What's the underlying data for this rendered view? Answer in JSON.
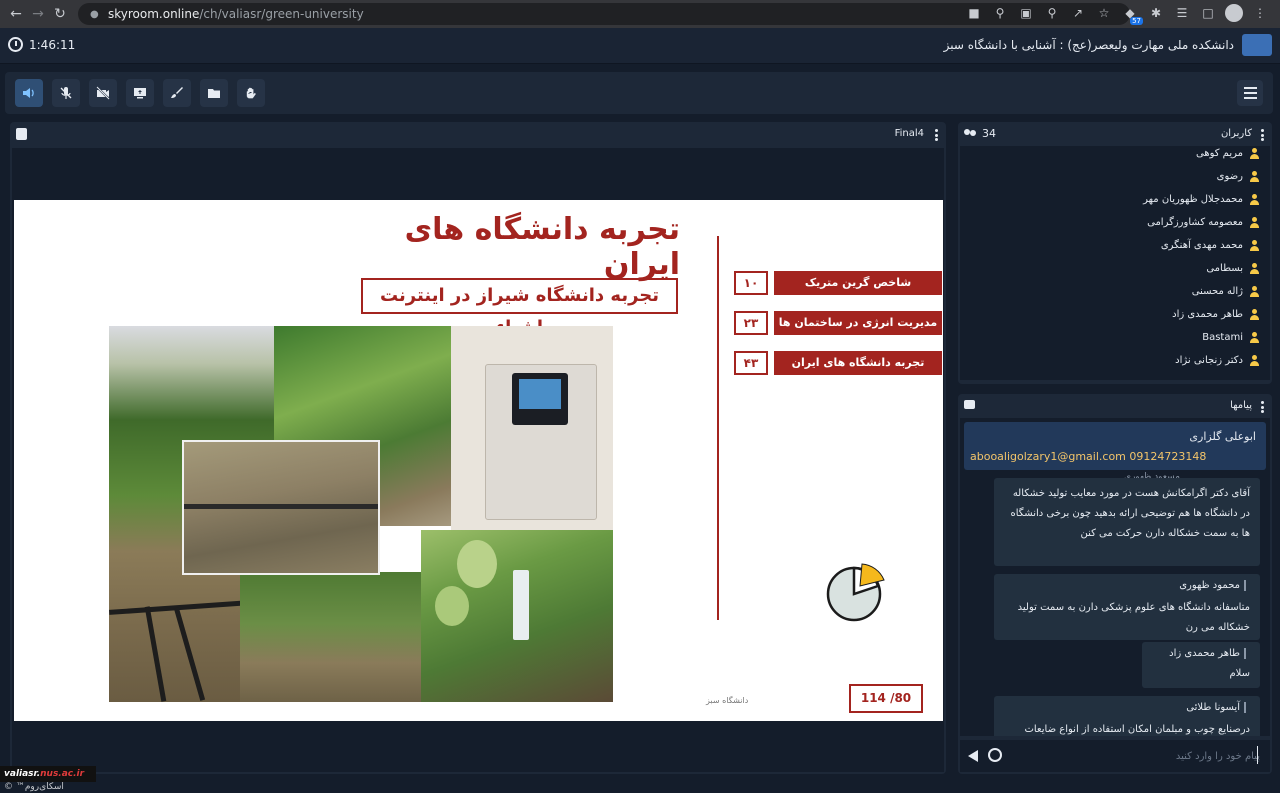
{
  "browser": {
    "url_host": "skyroom.online",
    "url_path": "/ch/valiasr/green-university",
    "extension_badge": "57"
  },
  "header": {
    "timer": "1:46:11",
    "title": "دانشکده ملی مهارت ولیعصر(عج) : آشنایی با دانشگاه سبز"
  },
  "presentation": {
    "file_name": "Final4",
    "slide": {
      "title": "تجربه دانشگاه های ایران",
      "subtitle": "تجربه دانشگاه شیراز در اینترنت اشیاء",
      "toc": [
        {
          "num": "۱۰",
          "label": "شاخص گرین متریک"
        },
        {
          "num": "۲۳",
          "label": "مدیریت انرژی در ساختمان ها"
        },
        {
          "num": "۴۳",
          "label": "تجربه دانشگاه های ایران"
        }
      ],
      "page": "114 /80",
      "caption": "دانشگاه سبز"
    }
  },
  "users": {
    "title": "کاربران",
    "count": "34",
    "list": [
      "مریم کوهی",
      "رضوی",
      "محمدجلال ظهوریان مهر",
      "معصومه کشاورزگرامی",
      "محمد مهدی آهنگری",
      "بسطامی",
      "ژاله محسنی",
      "طاهر محمدی زاد",
      "Bastami",
      "دکتر زنجانی نژاد"
    ]
  },
  "messages": {
    "title": "پیامها",
    "pinned": {
      "name": "ابوعلی گلزاری",
      "text": "abooaligolzary1@gmail.com 09124723148"
    },
    "partial_name": "مسعود ظهوری",
    "items": [
      {
        "name": "",
        "text": "آقای دکتر اگرامکانش هست در مورد معایب تولید خشکاله در دانشگاه ها هم توضیحی ارائه بدهید چون برخی دانشگاه ها به سمت خشکاله دارن حرکت می کنن"
      },
      {
        "name": "محمود ظهوری",
        "text": "متاسفانه دانشگاه های علوم پزشکی دارن به سمت تولید خشکاله می رن"
      },
      {
        "name": "طاهر محمدی زاد",
        "text": "سلام"
      },
      {
        "name": "آیسونا طلائی",
        "text": "درصنایع چوب و مبلمان امکان استفاده از انواع ضایعات وجود دارد"
      }
    ],
    "compose_placeholder": "پیام خود را وارد کنید"
  },
  "watermark": {
    "prefix": "valiasr.",
    "suffix": "nus.ac.ir",
    "brand": "اسکای‌روم™ ©"
  },
  "colors": {
    "accent": "#a3241f",
    "panel": "#1d2838",
    "highlight": "#f3c56a"
  }
}
